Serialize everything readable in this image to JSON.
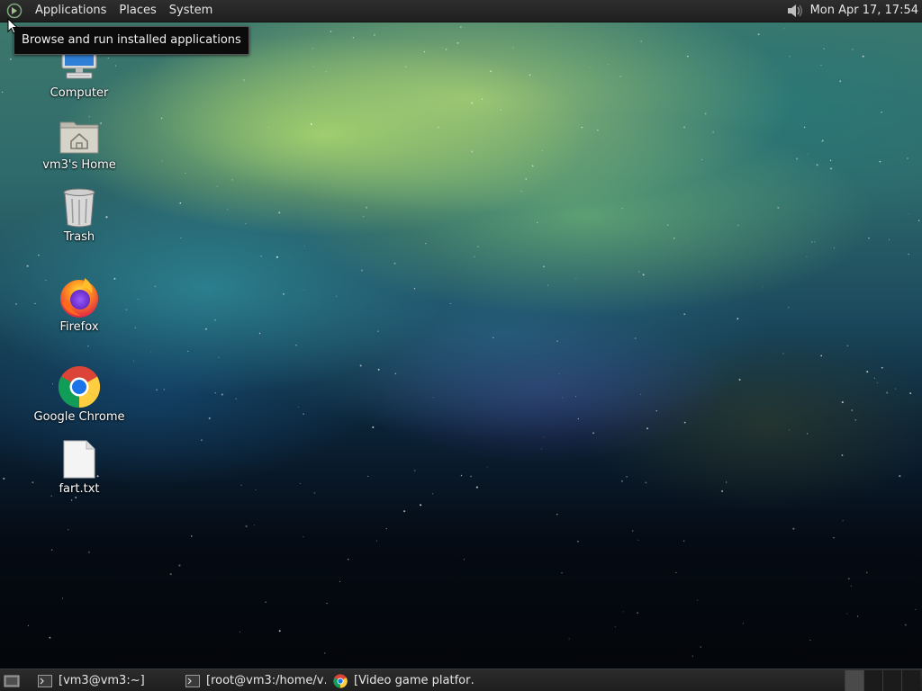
{
  "top_panel": {
    "menus": [
      "Applications",
      "Places",
      "System"
    ],
    "clock": "Mon Apr 17, 17:54"
  },
  "tooltip": {
    "text": "Browse and run installed applications"
  },
  "desktop": {
    "icons": [
      {
        "label": "Computer",
        "icon": "computer-icon"
      },
      {
        "label": "vm3's Home",
        "icon": "home-folder-icon"
      },
      {
        "label": "Trash",
        "icon": "trash-icon"
      },
      {
        "label": "Firefox",
        "icon": "firefox-icon"
      },
      {
        "label": "Google Chrome",
        "icon": "chrome-icon"
      },
      {
        "label": "fart.txt",
        "icon": "text-file-icon"
      }
    ]
  },
  "bottom_panel": {
    "tasks": [
      {
        "label": "[vm3@vm3:~]",
        "icon": "terminal-icon"
      },
      {
        "label": "[root@vm3:/home/v…",
        "icon": "terminal-icon"
      },
      {
        "label": "[Video game platfor…",
        "icon": "chrome-icon"
      }
    ],
    "workspaces": 4
  },
  "colors": {
    "panel": "#2a2a2a",
    "tooltip_bg": "#0b0b0b",
    "text": "#e6e6e6"
  }
}
